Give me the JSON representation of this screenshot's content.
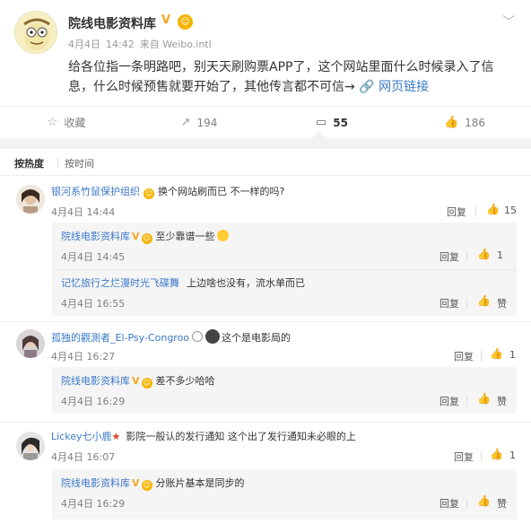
{
  "post": {
    "author": "院线电影资料库",
    "verified_badge": "V",
    "date": "4月4日",
    "time": "14:42",
    "source": "来自 Weibo.intl",
    "text": "给各位指一条明路吧，别天天刷购票APP了，这个网站里面什么时候录入了信息，什么时候预售就要开始了，其他传言都不可信→",
    "link_icon": "🔗",
    "link_label": "网页链接"
  },
  "actions": {
    "favorite_label": "收藏",
    "repost_count": "194",
    "comment_count": "55",
    "like_count": "186"
  },
  "sort": {
    "by_hot": "按热度",
    "by_time": "按时间"
  },
  "reply_label": "回复",
  "like_label": "赞",
  "comments": [
    {
      "user": "银河系竹鼠保护组织",
      "text": "换个网站刷而已 不一样的吗?",
      "date": "4月4日",
      "time": "14:44",
      "likes": "15",
      "replies": [
        {
          "user": "院线电影资料库",
          "text": "至少靠谱一些",
          "date": "4月4日",
          "time": "14:45",
          "likes": "1"
        },
        {
          "user": "记忆旅行之烂漫时光飞碟舞",
          "text": "上边啥也没有，流水单而已",
          "date": "4月4日",
          "time": "16:55",
          "likes": "赞"
        }
      ]
    },
    {
      "user": "孤独的觀測者_El-Psy-Congroo",
      "text": "这个是电影局的",
      "date": "4月4日",
      "time": "16:27",
      "likes": "1",
      "replies": [
        {
          "user": "院线电影资料库",
          "text": "差不多少哈哈",
          "date": "4月4日",
          "time": "16:29",
          "likes": "赞"
        }
      ]
    },
    {
      "user": "Lickey七小鹿",
      "text": "影院一般认的发行通知 这个出了发行通知未必眼的上",
      "date": "4月4日",
      "time": "16:07",
      "likes": "1",
      "replies": [
        {
          "user": "院线电影资料库",
          "text": "分账片基本是同步的",
          "date": "4月4日",
          "time": "16:29",
          "likes": "赞"
        }
      ]
    }
  ]
}
